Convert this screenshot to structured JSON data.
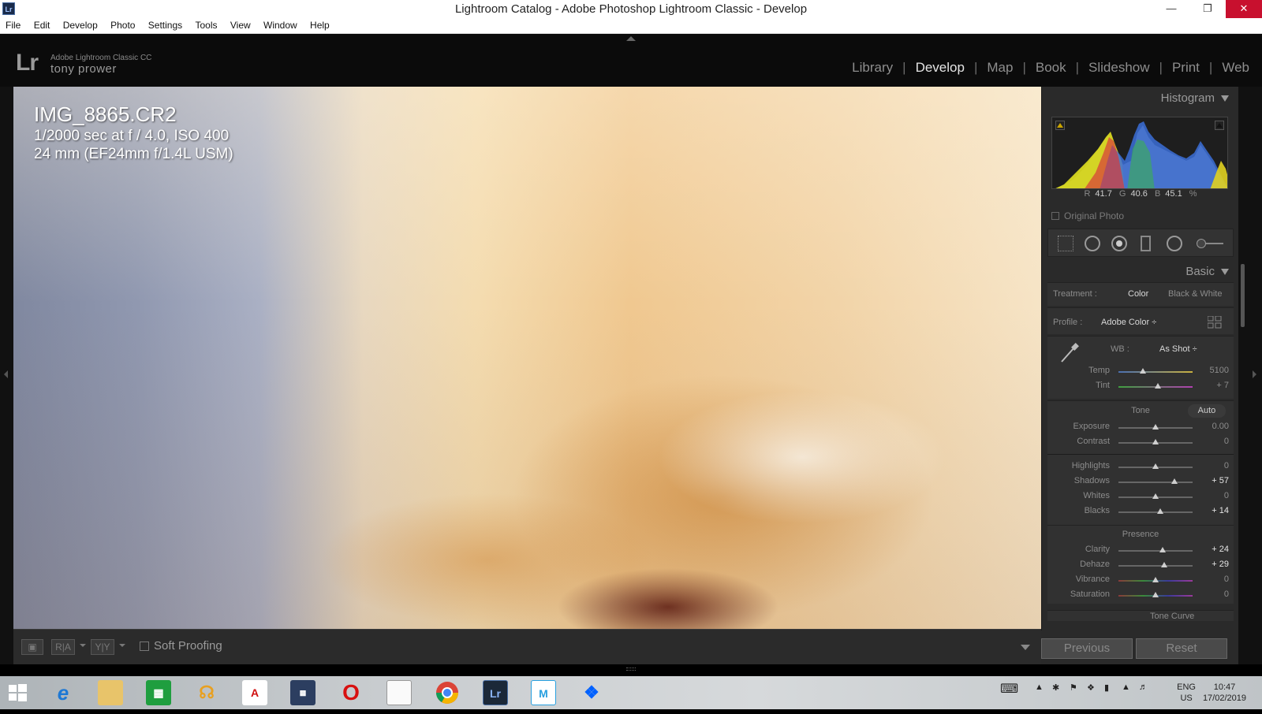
{
  "window": {
    "app_icon": "Lr",
    "title": "Lightroom Catalog - Adobe Photoshop Lightroom Classic - Develop",
    "minimize_icon": "minimize-icon",
    "maximize_icon": "restore-icon",
    "close_icon": "close-icon"
  },
  "menu": {
    "items": [
      "File",
      "Edit",
      "Develop",
      "Photo",
      "Settings",
      "Tools",
      "View",
      "Window",
      "Help"
    ]
  },
  "identity": {
    "logo": "Lr",
    "product": "Adobe Lightroom Classic CC",
    "user": "tony prower"
  },
  "modules": {
    "items": [
      "Library",
      "Develop",
      "Map",
      "Book",
      "Slideshow",
      "Print",
      "Web"
    ],
    "active": "Develop"
  },
  "photo": {
    "filename": "IMG_8865.CR2",
    "exposure_line": "1/2000 sec at f / 4.0, ISO 400",
    "lens_line": "24 mm (EF24mm f/1.4L USM)"
  },
  "toolbar": {
    "soft_proofing_label": "Soft Proofing",
    "soft_proofing_checked": false,
    "view_buttons": [
      "loupe-view-icon",
      "before-after-icon",
      "before-after-split-icon"
    ],
    "ra_label": "R|A",
    "yy_label": "Y|Y"
  },
  "histogram": {
    "title": "Histogram",
    "r_label": "R",
    "r_value": "41.7",
    "g_label": "G",
    "g_value": "40.6",
    "b_label": "B",
    "b_value": "45.1",
    "percent": "%",
    "original_photo_label": "Original Photo"
  },
  "basic": {
    "title": "Basic",
    "treatment_label": "Treatment :",
    "treatment_color": "Color",
    "treatment_bw": "Black & White",
    "profile_label": "Profile :",
    "profile_value": "Adobe Color ÷",
    "wb_label": "WB :",
    "wb_value": "As Shot ÷",
    "tone_label": "Tone",
    "auto_label": "Auto",
    "presence_label": "Presence",
    "next_panel": "Tone Curve",
    "sliders": {
      "temp": {
        "name": "Temp",
        "value": "5100",
        "position": 0.33
      },
      "tint": {
        "name": "Tint",
        "value": "+ 7",
        "position": 0.53
      },
      "exposure": {
        "name": "Exposure",
        "value": "0.00",
        "position": 0.5
      },
      "contrast": {
        "name": "Contrast",
        "value": "0",
        "position": 0.5
      },
      "highlights": {
        "name": "Highlights",
        "value": "0",
        "position": 0.5
      },
      "shadows": {
        "name": "Shadows",
        "value": "+ 57",
        "position": 0.76
      },
      "whites": {
        "name": "Whites",
        "value": "0",
        "position": 0.5
      },
      "blacks": {
        "name": "Blacks",
        "value": "+ 14",
        "position": 0.56
      },
      "clarity": {
        "name": "Clarity",
        "value": "+ 24",
        "position": 0.6
      },
      "dehaze": {
        "name": "Dehaze",
        "value": "+ 29",
        "position": 0.62
      },
      "vibrance": {
        "name": "Vibrance",
        "value": "0",
        "position": 0.5
      },
      "saturation": {
        "name": "Saturation",
        "value": "0",
        "position": 0.5
      }
    }
  },
  "buttons": {
    "previous": "Previous",
    "reset": "Reset"
  },
  "taskbar": {
    "lang_top": "ENG",
    "lang_bottom": "US",
    "time": "10:47",
    "date": "17/02/2019",
    "apps": [
      "windows-start-icon",
      "internet-explorer-icon",
      "file-explorer-icon",
      "store-icon",
      "headphones-app-icon",
      "adobe-icon",
      "lenovo-icon",
      "opera-icon",
      "document-icon",
      "chrome-icon",
      "lightroom-icon",
      "m-app-icon",
      "dropbox-icon"
    ]
  },
  "colors": {
    "active_module": "#e5e5e5",
    "panel_bg": "#2a2a2a",
    "close_red": "#c8102e"
  }
}
